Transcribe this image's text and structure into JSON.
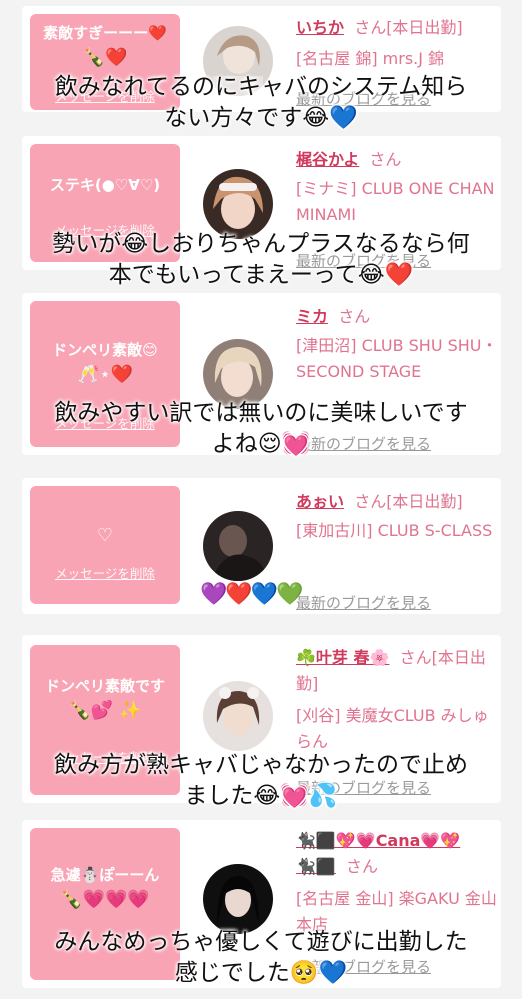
{
  "cards": [
    {
      "bubble": {
        "message": "素敵すぎーーー❤️",
        "emoji": "🍾❤️",
        "delete_label": "メッセージを削除"
      },
      "name": "いちか",
      "suffix": "さん[本日出勤]",
      "store": "[名古屋 錦] mrs.J 錦",
      "blog_label": "最新のブログを見る"
    },
    {
      "bubble": {
        "message": "ステキ(●♡∀♡)",
        "emoji": "",
        "delete_label": "メッセージを削除"
      },
      "name": "梶谷かよ",
      "suffix": "さん",
      "store": "[ミナミ] CLUB ONE CHAN MINAMI",
      "blog_label": "最新のブログを見る"
    },
    {
      "bubble": {
        "message": "ドンペリ素敵😊",
        "emoji": "🥂⋆❤️",
        "delete_label": "メッセージを削除"
      },
      "name": "ミカ",
      "suffix": "さん",
      "store": "[津田沼] CLUB SHU SHU・SECOND STAGE",
      "blog_label": "最新のブログを見る"
    },
    {
      "bubble": {
        "message": "♡",
        "emoji": "",
        "delete_label": "メッセージを削除"
      },
      "name": "あぉい",
      "suffix": "さん[本日出勤]",
      "store": "[東加古川] CLUB S-CLASS",
      "blog_label": "最新のブログを見る"
    },
    {
      "bubble": {
        "message": "ドンペリ素敵です",
        "emoji": "🍾💕 ✨",
        "delete_label": "メッセージを削除"
      },
      "name": "☘️叶芽 春🌸",
      "suffix": "さん[本日出勤]",
      "store": "[刈谷] 美魔女CLUB みしゅらん",
      "blog_label": "最新のブログを見る"
    },
    {
      "bubble": {
        "message": "急遽☃️ぽーーん",
        "emoji": "🍾💗💗💗",
        "delete_label": "メッセージを削除"
      },
      "name": "🐈‍⬛⬛💖💗Cana💗💖🐈‍⬛⬛",
      "suffix": "さん",
      "store": "[名古屋 金山] 楽GAKU 金山本店",
      "blog_label": "最新のブログを見る"
    }
  ],
  "captions": [
    {
      "line1": "飲みなれてるのにキャバのシステム知ら",
      "line2": "ない方々です😂💙"
    },
    {
      "line1": "勢いが😂しおりちゃんプラスなるなら何",
      "line2": "本でもいってまえーって😂❤️"
    },
    {
      "line1": "飲みやすい訳では無いのに美味しいです",
      "line2": "よね😌💓"
    },
    {
      "line1": "💜❤️💙💚",
      "line2": ""
    },
    {
      "line1": "飲み方が熟キャバじゃなかったので止め",
      "line2": "ました😂💓💦"
    },
    {
      "line1": "みんなめっちゃ優しくて遊びに出勤した",
      "line2": "感じでした🥺💙"
    }
  ],
  "colors": {
    "bubble": "#f8a4b4",
    "name": "#d23a5d",
    "store": "#e0748f",
    "background": "#f3f3f3"
  }
}
